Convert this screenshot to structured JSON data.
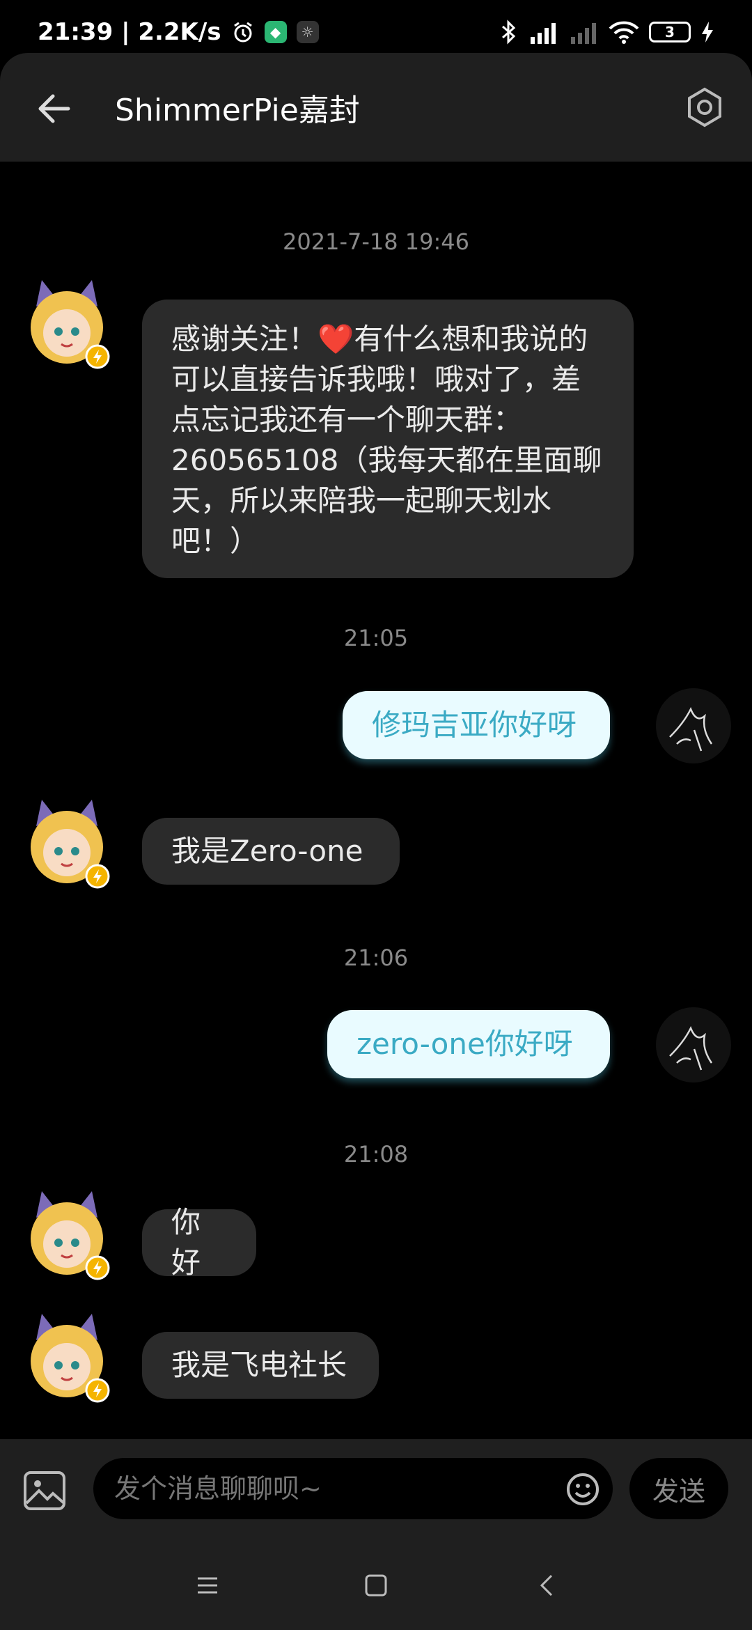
{
  "status_bar": {
    "time_speed": "21:39 | 2.2K/s",
    "battery": "3"
  },
  "header": {
    "title": "ShimmerPie嘉封"
  },
  "messages": [
    {
      "type": "timestamp",
      "text": "2021-7-18 19:46"
    },
    {
      "type": "incoming",
      "lines": [
        "感谢关注！❤️有什么想和我说的",
        "可以直接告诉我哦！哦对了，差",
        "点忘记我还有一个聊天群：",
        "260565108（我每天都在里面聊",
        "天，所以来陪我一起聊天划水",
        "吧！）"
      ]
    },
    {
      "type": "timestamp",
      "text": "21:05"
    },
    {
      "type": "outgoing",
      "text": "修玛吉亚你好呀"
    },
    {
      "type": "incoming",
      "text": "我是Zero-one"
    },
    {
      "type": "timestamp",
      "text": "21:06"
    },
    {
      "type": "outgoing",
      "text": "zero-one你好呀"
    },
    {
      "type": "timestamp",
      "text": "21:08"
    },
    {
      "type": "incoming",
      "text": "你好"
    },
    {
      "type": "incoming",
      "text": "我是飞电社长"
    }
  ],
  "input": {
    "placeholder": "发个消息聊聊呗~",
    "send_label": "发送"
  },
  "colors": {
    "incoming_bubble": "#2b2b2b",
    "outgoing_bubble": "#e9fbff",
    "outgoing_text": "#3aaac4",
    "background": "#000000"
  }
}
